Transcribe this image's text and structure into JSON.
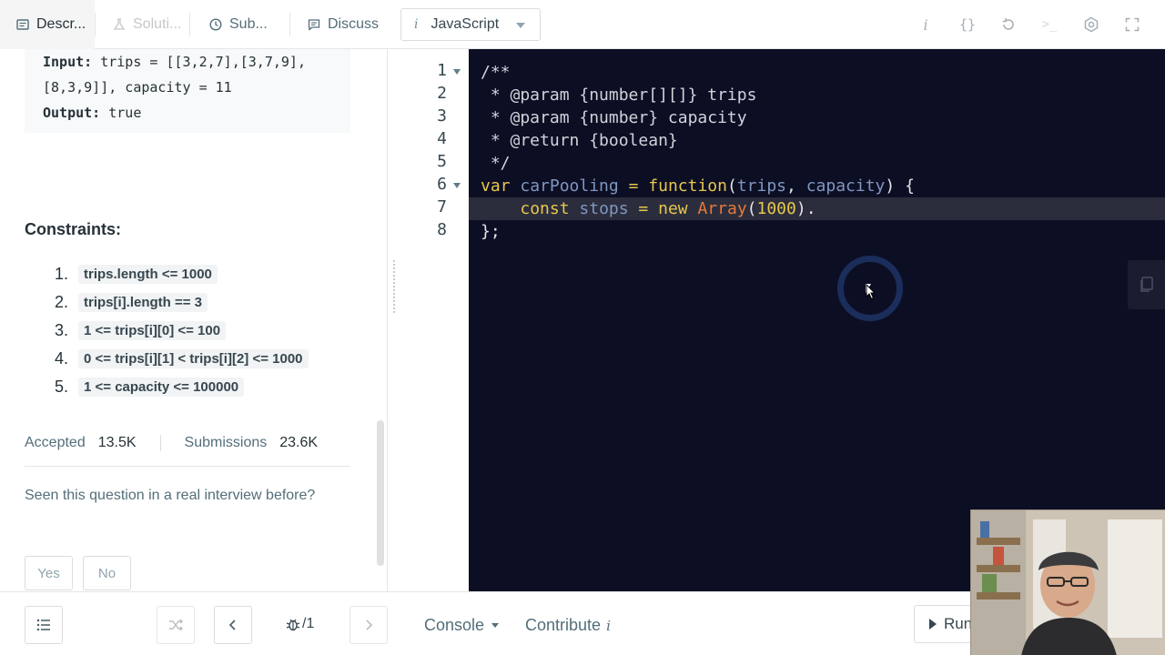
{
  "tabs": [
    {
      "label": "Descr...",
      "icon": "description-icon"
    },
    {
      "label": "Soluti...",
      "icon": "flask-icon"
    },
    {
      "label": "Sub...",
      "icon": "clock-icon"
    },
    {
      "label": "Discuss",
      "icon": "comment-icon"
    }
  ],
  "language": {
    "label": "JavaScript",
    "icon": "info-icon"
  },
  "toolbar_icons": [
    "info-icon",
    "braces-icon",
    "reset-icon",
    "terminal-icon",
    "settings-icon",
    "fullscreen-icon"
  ],
  "example": {
    "input_label": "Input:",
    "input_line1": " trips = [[3,2,7],[3,7,9],",
    "input_line2": "[8,3,9]], capacity = 11",
    "output_label": "Output:",
    "output_value": " true"
  },
  "constraints": {
    "title": "Constraints:",
    "items": [
      {
        "num": "1.",
        "text": "trips.length <= 1000"
      },
      {
        "num": "2.",
        "text": "trips[i].length == 3"
      },
      {
        "num": "3.",
        "text": "1 <= trips[i][0] <= 100"
      },
      {
        "num": "4.",
        "text": "0 <= trips[i][1] < trips[i][2] <= 1000"
      },
      {
        "num": "5.",
        "text": "1 <= capacity <= 100000"
      }
    ]
  },
  "stats": {
    "accepted_label": "Accepted",
    "accepted_value": "13.5K",
    "submissions_label": "Submissions",
    "submissions_value": "23.6K"
  },
  "interview": {
    "question": "Seen this question in a real interview before?",
    "yes": "Yes",
    "no": "No"
  },
  "editor": {
    "line_numbers": [
      "1",
      "2",
      "3",
      "4",
      "5",
      "6",
      "7",
      "8"
    ],
    "code_lines": [
      "/**",
      " * @param {number[][]} trips",
      " * @param {number} capacity",
      " * @return {boolean}",
      " */",
      "var carPooling = function(trips, capacity) {",
      "    const stops = new Array(1000).",
      "};"
    ]
  },
  "bottom": {
    "pager": "/1",
    "console": "Console",
    "contribute": "Contribute",
    "contribute_icon": "i",
    "run": "Run"
  },
  "colors": {
    "editor_bg": "#0c0e24",
    "keyword": "#e6c74c",
    "variable": "#7f97c0",
    "class": "#e8783a"
  }
}
